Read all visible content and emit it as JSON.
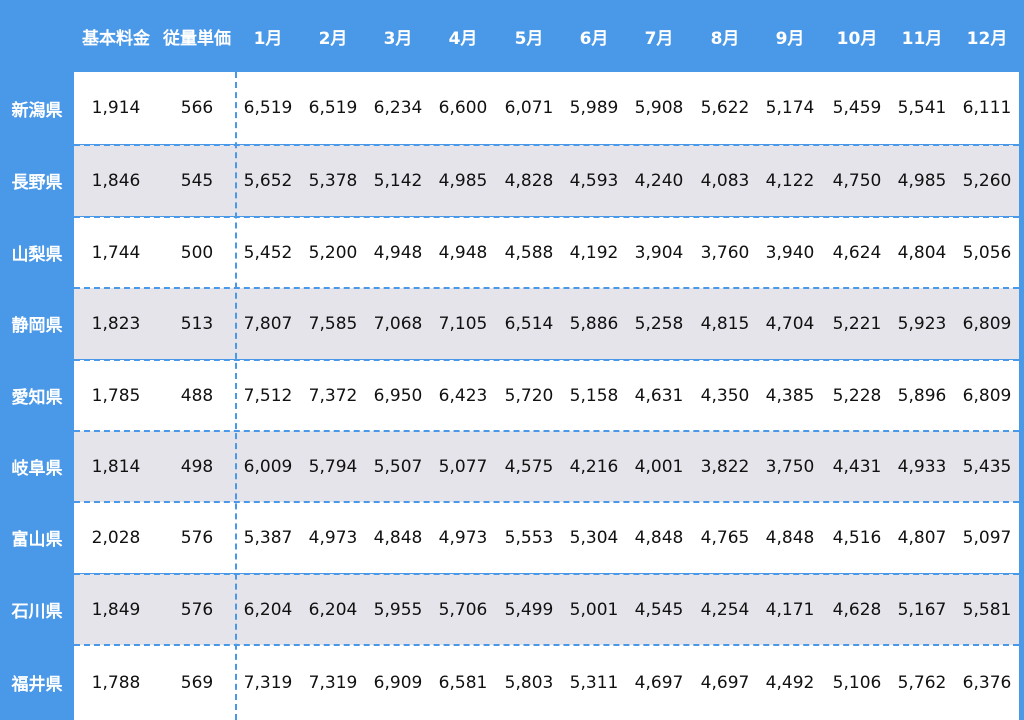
{
  "header": {
    "columns": [
      "基本料金",
      "従量単価",
      "1月",
      "2月",
      "3月",
      "4月",
      "5月",
      "6月",
      "7月",
      "8月",
      "9月",
      "10月",
      "11月",
      "12月"
    ]
  },
  "rows": [
    {
      "pref": "新潟県",
      "values": [
        "1,914",
        "566",
        "6,519",
        "6,519",
        "6,234",
        "6,600",
        "6,071",
        "5,989",
        "5,908",
        "5,622",
        "5,174",
        "5,459",
        "5,541",
        "6,111"
      ]
    },
    {
      "pref": "長野県",
      "values": [
        "1,846",
        "545",
        "5,652",
        "5,378",
        "5,142",
        "4,985",
        "4,828",
        "4,593",
        "4,240",
        "4,083",
        "4,122",
        "4,750",
        "4,985",
        "5,260"
      ]
    },
    {
      "pref": "山梨県",
      "values": [
        "1,744",
        "500",
        "5,452",
        "5,200",
        "4,948",
        "4,948",
        "4,588",
        "4,192",
        "3,904",
        "3,760",
        "3,940",
        "4,624",
        "4,804",
        "5,056"
      ]
    },
    {
      "pref": "静岡県",
      "values": [
        "1,823",
        "513",
        "7,807",
        "7,585",
        "7,068",
        "7,105",
        "6,514",
        "5,886",
        "5,258",
        "4,815",
        "4,704",
        "5,221",
        "5,923",
        "6,809"
      ]
    },
    {
      "pref": "愛知県",
      "values": [
        "1,785",
        "488",
        "7,512",
        "7,372",
        "6,950",
        "6,423",
        "5,720",
        "5,158",
        "4,631",
        "4,350",
        "4,385",
        "5,228",
        "5,896",
        "6,809"
      ]
    },
    {
      "pref": "岐阜県",
      "values": [
        "1,814",
        "498",
        "6,009",
        "5,794",
        "5,507",
        "5,077",
        "4,575",
        "4,216",
        "4,001",
        "3,822",
        "3,750",
        "4,431",
        "4,933",
        "5,435"
      ]
    },
    {
      "pref": "富山県",
      "values": [
        "2,028",
        "576",
        "5,387",
        "4,973",
        "4,848",
        "4,973",
        "5,553",
        "5,304",
        "4,848",
        "4,765",
        "4,848",
        "4,516",
        "4,807",
        "5,097"
      ]
    },
    {
      "pref": "石川県",
      "values": [
        "1,849",
        "576",
        "6,204",
        "6,204",
        "5,955",
        "5,706",
        "5,499",
        "5,001",
        "4,545",
        "4,254",
        "4,171",
        "4,628",
        "5,167",
        "5,581"
      ]
    },
    {
      "pref": "福井県",
      "values": [
        "1,788",
        "569",
        "7,319",
        "7,319",
        "6,909",
        "6,581",
        "5,803",
        "5,311",
        "4,697",
        "4,697",
        "4,492",
        "5,106",
        "5,762",
        "6,376"
      ]
    }
  ],
  "colors": {
    "header_bg": "#4a98e8",
    "row_alt": "#e4e4ea",
    "row_base": "#ffffff"
  }
}
